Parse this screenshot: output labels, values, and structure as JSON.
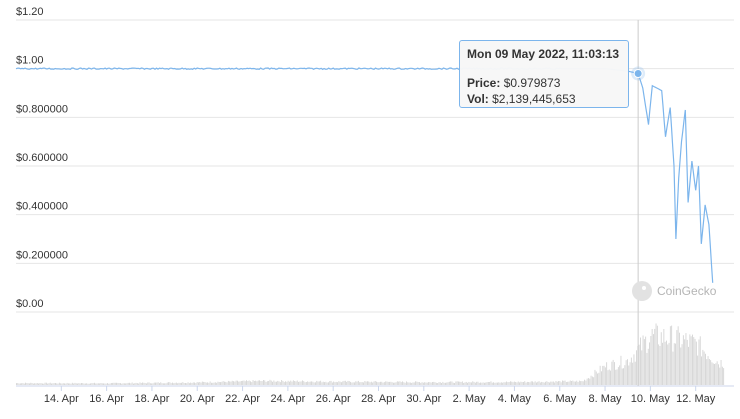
{
  "chart_data": {
    "type": "line",
    "x_range": [
      "2022-04-12",
      "2022-05-13"
    ],
    "ylim": [
      0,
      1.2
    ],
    "y_ticks": [
      {
        "value": 1.2,
        "label": "$1.20"
      },
      {
        "value": 1.0,
        "label": "$1.00"
      },
      {
        "value": 0.8,
        "label": "$0.800000"
      },
      {
        "value": 0.6,
        "label": "$0.600000"
      },
      {
        "value": 0.4,
        "label": "$0.400000"
      },
      {
        "value": 0.2,
        "label": "$0.200000"
      },
      {
        "value": 0.0,
        "label": "$0.00"
      }
    ],
    "x_ticks": [
      {
        "date": "2022-04-14",
        "label": "14. Apr"
      },
      {
        "date": "2022-04-16",
        "label": "16. Apr"
      },
      {
        "date": "2022-04-18",
        "label": "18. Apr"
      },
      {
        "date": "2022-04-20",
        "label": "20. Apr"
      },
      {
        "date": "2022-04-22",
        "label": "22. Apr"
      },
      {
        "date": "2022-04-24",
        "label": "24. Apr"
      },
      {
        "date": "2022-04-26",
        "label": "26. Apr"
      },
      {
        "date": "2022-04-28",
        "label": "28. Apr"
      },
      {
        "date": "2022-04-30",
        "label": "30. Apr"
      },
      {
        "date": "2022-05-02",
        "label": "2. May"
      },
      {
        "date": "2022-05-04",
        "label": "4. May"
      },
      {
        "date": "2022-05-06",
        "label": "6. May"
      },
      {
        "date": "2022-05-08",
        "label": "8. May"
      },
      {
        "date": "2022-05-10",
        "label": "10. May"
      },
      {
        "date": "2022-05-12",
        "label": "12. May"
      }
    ],
    "grid": true,
    "series": [
      {
        "color": "#7cb5ec",
        "points": [
          [
            "2022-04-12",
            1.0
          ],
          [
            "2022-04-15",
            1.0
          ],
          [
            "2022-04-18",
            1.0
          ],
          [
            "2022-04-21",
            1.0
          ],
          [
            "2022-04-24",
            1.0
          ],
          [
            "2022-04-27",
            1.0
          ],
          [
            "2022-04-30",
            1.0
          ],
          [
            "2022-05-03",
            1.0
          ],
          [
            "2022-05-06",
            1.0
          ],
          [
            "2022-05-08",
            1.0
          ],
          [
            "2022-05-09T00:00",
            0.99
          ],
          [
            "2022-05-09T11:03",
            0.98
          ],
          [
            "2022-05-09T16:00",
            0.92
          ],
          [
            "2022-05-09T22:00",
            0.77
          ],
          [
            "2022-05-10T02:00",
            0.93
          ],
          [
            "2022-05-10T07:00",
            0.92
          ],
          [
            "2022-05-10T12:00",
            0.91
          ],
          [
            "2022-05-10T16:00",
            0.72
          ],
          [
            "2022-05-10T21:00",
            0.84
          ],
          [
            "2022-05-11T01:00",
            0.6
          ],
          [
            "2022-05-11T03:00",
            0.3
          ],
          [
            "2022-05-11T06:00",
            0.55
          ],
          [
            "2022-05-11T09:00",
            0.7
          ],
          [
            "2022-05-11T13:00",
            0.83
          ],
          [
            "2022-05-11T16:00",
            0.45
          ],
          [
            "2022-05-11T20:00",
            0.62
          ],
          [
            "2022-05-12T00:00",
            0.5
          ],
          [
            "2022-05-12T03:00",
            0.6
          ],
          [
            "2022-05-12T06:00",
            0.28
          ],
          [
            "2022-05-12T10:00",
            0.44
          ],
          [
            "2022-05-12T14:00",
            0.36
          ],
          [
            "2022-05-12T18:00",
            0.12
          ]
        ]
      },
      {
        "kind": "volume",
        "color": "#d4d4d4",
        "values_usd": [
          [
            "2022-04-12",
            100000000.0
          ],
          [
            "2022-04-16",
            90000000.0
          ],
          [
            "2022-04-20",
            140000000.0
          ],
          [
            "2022-04-23",
            220000000.0
          ],
          [
            "2022-04-26",
            180000000.0
          ],
          [
            "2022-04-30",
            150000000.0
          ],
          [
            "2022-05-04",
            160000000.0
          ],
          [
            "2022-05-07",
            200000000.0
          ],
          [
            "2022-05-08",
            1000000000.0
          ],
          [
            "2022-05-09",
            1300000000.0
          ],
          [
            "2022-05-10",
            2600000000.0
          ],
          [
            "2022-05-11",
            2500000000.0
          ],
          [
            "2022-05-12",
            2200000000.0
          ],
          [
            "2022-05-13",
            1200000000.0
          ]
        ]
      }
    ],
    "hover_date": "2022-05-09T11:03:13"
  },
  "tooltip": {
    "date": "Mon 09 May 2022, 11:03:13",
    "price_label": "Price:",
    "price_value": "$0.979873",
    "vol_label": "Vol:",
    "vol_value": "$2,139,445,653"
  },
  "watermark": "CoinGecko"
}
